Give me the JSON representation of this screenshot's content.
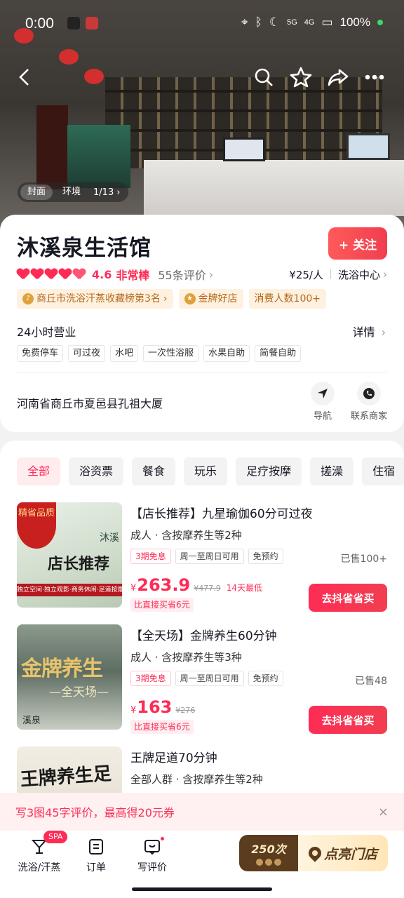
{
  "status_bar": {
    "time": "0:00",
    "battery": "100%",
    "network_5g": "5G",
    "network_4g": "4G"
  },
  "gallery": {
    "tabs": [
      "封面",
      "环境"
    ],
    "count": "1/13"
  },
  "shop": {
    "name": "沐溪泉生活馆",
    "follow_label": "+ 关注",
    "score": "4.6",
    "score_level": "非常棒",
    "review_count": "55条评价",
    "price_per_person": "¥25/人",
    "category": "洗浴中心",
    "badges": [
      "商丘市洗浴汗蒸收藏榜第3名",
      "金牌好店",
      "消费人数100+"
    ],
    "hours": "24小时营业",
    "details_label": "详情",
    "facilities": [
      "免费停车",
      "可过夜",
      "水吧",
      "一次性浴服",
      "水果自助",
      "简餐自助"
    ],
    "address": "河南省商丘市夏邑县孔祖大厦",
    "nav_label": "导航",
    "call_label": "联系商家",
    "rating_hearts": 4.6
  },
  "categories": [
    "全部",
    "浴资票",
    "餐食",
    "玩乐",
    "足疗按摩",
    "搓澡",
    "住宿"
  ],
  "products": [
    {
      "title": "【店长推荐】九星瑜伽60分可过夜",
      "subtitle": "成人 · 含按摩养生等2种",
      "tags": [
        "3期免息",
        "周一至周日可用",
        "免预约"
      ],
      "sold": "已售100+",
      "yen": "¥",
      "price": "263.9",
      "original_price": "¥477.9",
      "lowest_label": "14天最低",
      "save_label": "比直接买省6元",
      "buy_label": "去抖省省买",
      "thumb": {
        "ribbon": "精省品质",
        "big": "店长推荐",
        "logo": "沐溪",
        "strip": "独立空间·独立观影·商务休闲·足道按摩"
      }
    },
    {
      "title": "【全天场】金牌养生60分钟",
      "subtitle": "成人 · 含按摩养生等3种",
      "tags": [
        "3期免息",
        "周一至周日可用",
        "免预约"
      ],
      "sold": "已售48",
      "yen": "¥",
      "price": "163",
      "original_price": "¥276",
      "lowest_label": "",
      "save_label": "比直接买省6元",
      "buy_label": "去抖省省买",
      "thumb": {
        "big": "金牌养生",
        "sub": "—全天场—",
        "logo": "溪泉"
      }
    },
    {
      "title": "王牌足道70分钟",
      "subtitle": "全部人群 · 含按摩养生等2种",
      "thumb": {
        "big": "王牌养生足道"
      }
    }
  ],
  "promo": {
    "text": "写3图45字评价，最高得20元券",
    "close": "×"
  },
  "bottom_bar": {
    "bath_label": "洗浴/汗蒸",
    "spa_badge": "SPA",
    "orders_label": "订单",
    "review_label": "写评价",
    "light_count": "250次",
    "light_label": "点亮门店"
  },
  "colors": {
    "accent": "#fe2c55",
    "follow_gradient_start": "#fe5a5a",
    "badge_bg": "#fff1e0",
    "light_brown": "#5b3c1e"
  }
}
